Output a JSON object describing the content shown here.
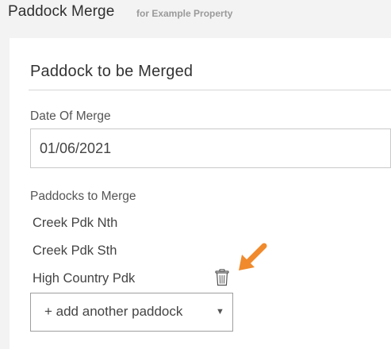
{
  "header": {
    "title": "Paddock Merge",
    "subtitle": "for Example Property"
  },
  "section": {
    "title": "Paddock to be Merged"
  },
  "date_field": {
    "label": "Date Of Merge",
    "value": "01/06/2021"
  },
  "paddocks": {
    "label": "Paddocks to Merge",
    "items": [
      {
        "name": "Creek Pdk Nth"
      },
      {
        "name": "Creek Pdk Sth"
      },
      {
        "name": "High Country Pdk"
      }
    ]
  },
  "add_select": {
    "label": "+ add another paddock"
  },
  "icons": {
    "delete": "trash-icon",
    "pointer": "arrow-icon",
    "dropdown": "caret-down-icon"
  },
  "colors": {
    "accent_orange": "#f08a2c"
  }
}
